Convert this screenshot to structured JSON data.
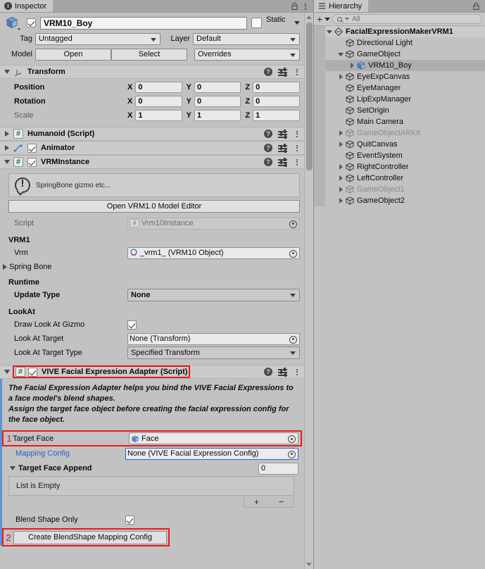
{
  "inspector": {
    "tab_label": "Inspector",
    "tab_icon": "info-icon",
    "object": {
      "name_value": "VRM10_Boy",
      "enabled": true,
      "static_label": "Static",
      "tag_label": "Tag",
      "tag_value": "Untagged",
      "layer_label": "Layer",
      "layer_value": "Default",
      "model_label": "Model",
      "open_label": "Open",
      "select_label": "Select",
      "overrides_label": "Overrides"
    },
    "transform": {
      "title": "Transform",
      "rows": [
        {
          "label": "Position",
          "x": "0",
          "y": "0",
          "z": "0"
        },
        {
          "label": "Rotation",
          "x": "0",
          "y": "0",
          "z": "0"
        },
        {
          "label": "Scale",
          "x": "1",
          "y": "1",
          "z": "1"
        }
      ],
      "axis": {
        "x": "X",
        "y": "Y",
        "z": "Z"
      }
    },
    "components": [
      {
        "title": "Humanoid (Script)",
        "has_checkbox": false
      },
      {
        "title": "Animator",
        "has_checkbox": true
      },
      {
        "title": "VRMInstance",
        "has_checkbox": true
      }
    ],
    "vrminstance": {
      "helpbox_text": "SpringBone gizmo etc...",
      "open_editor_button": "Open VRM1.0 Model Editor",
      "script_label": "Script",
      "script_value": "Vrm10Instance",
      "section_vrm1": "VRM1",
      "vrm_label": "Vrm",
      "vrm_value": "_vrm1_ (VRM10 Object)",
      "spring_bone_label": "Spring Bone",
      "section_runtime": "Runtime",
      "update_type_label": "Update Type",
      "update_type_value": "None",
      "section_lookat": "LookAt",
      "draw_gizmo_label": "Draw Look At Gizmo",
      "draw_gizmo_checked": true,
      "look_at_target_label": "Look At Target",
      "look_at_target_value": "None (Transform)",
      "look_at_type_label": "Look At Target Type",
      "look_at_type_value": "Specified Transform"
    },
    "vive_adapter": {
      "title": "VIVE Facial Expression Adapter (Script)",
      "enabled": true,
      "description": "The Facial Expression Adapter helps you bind the VIVE Facial Expressions to a face model's blend shapes.\nAssign the target face object before creating the facial expression config for the face object.",
      "marker_1": "1",
      "target_face_label": "Target Face",
      "target_face_value": "Face",
      "mapping_config_label": "Mapping Config",
      "mapping_config_value": "None (VIVE Facial Expression Config)",
      "target_face_append_label": "Target Face Append",
      "target_face_append_count": "0",
      "list_empty_label": "List is Empty",
      "list_add": "+",
      "list_remove": "−",
      "blend_shape_only_label": "Blend Shape Only",
      "blend_shape_only_checked": true,
      "marker_2": "2",
      "create_button_label": "Create BlendShape Mapping Config"
    }
  },
  "hierarchy": {
    "tab_label": "Hierarchy",
    "tab_icon": "hierarchy-icon",
    "add_button": "+",
    "search_placeholder": "All",
    "items": [
      {
        "label": "FacialExpressionMakerVRM1",
        "depth": 0,
        "icon": "scene-icon",
        "twisty": "down",
        "scene": true,
        "dimmed": false,
        "selected": false
      },
      {
        "label": "Directional Light",
        "depth": 1,
        "icon": "gameobject-icon",
        "twisty": "none",
        "scene": false,
        "dimmed": false,
        "selected": false
      },
      {
        "label": "GameObject",
        "depth": 1,
        "icon": "gameobject-icon",
        "twisty": "down",
        "scene": false,
        "dimmed": false,
        "selected": false
      },
      {
        "label": "VRM10_Boy",
        "depth": 2,
        "icon": "prefab-icon",
        "twisty": "right",
        "scene": false,
        "dimmed": false,
        "selected": true
      },
      {
        "label": "EyeExpCanvas",
        "depth": 1,
        "icon": "gameobject-icon",
        "twisty": "right",
        "scene": false,
        "dimmed": false,
        "selected": false
      },
      {
        "label": "EyeManager",
        "depth": 1,
        "icon": "gameobject-icon",
        "twisty": "none",
        "scene": false,
        "dimmed": false,
        "selected": false
      },
      {
        "label": "LipExpManager",
        "depth": 1,
        "icon": "gameobject-icon",
        "twisty": "none",
        "scene": false,
        "dimmed": false,
        "selected": false
      },
      {
        "label": "SetOrigin",
        "depth": 1,
        "icon": "gameobject-icon",
        "twisty": "none",
        "scene": false,
        "dimmed": false,
        "selected": false
      },
      {
        "label": "Main Camera",
        "depth": 1,
        "icon": "gameobject-icon",
        "twisty": "none",
        "scene": false,
        "dimmed": false,
        "selected": false
      },
      {
        "label": "GameObjectARKit",
        "depth": 1,
        "icon": "gameobject-icon",
        "twisty": "right",
        "scene": false,
        "dimmed": true,
        "selected": false
      },
      {
        "label": "QuitCanvas",
        "depth": 1,
        "icon": "gameobject-icon",
        "twisty": "right",
        "scene": false,
        "dimmed": false,
        "selected": false
      },
      {
        "label": "EventSystem",
        "depth": 1,
        "icon": "gameobject-icon",
        "twisty": "none",
        "scene": false,
        "dimmed": false,
        "selected": false
      },
      {
        "label": "RightController",
        "depth": 1,
        "icon": "gameobject-icon",
        "twisty": "right",
        "scene": false,
        "dimmed": false,
        "selected": false
      },
      {
        "label": "LeftController",
        "depth": 1,
        "icon": "gameobject-icon",
        "twisty": "right",
        "scene": false,
        "dimmed": false,
        "selected": false
      },
      {
        "label": "GameObject1",
        "depth": 1,
        "icon": "gameobject-icon",
        "twisty": "right",
        "scene": false,
        "dimmed": true,
        "selected": false
      },
      {
        "label": "GameObject2",
        "depth": 1,
        "icon": "gameobject-icon",
        "twisty": "right",
        "scene": false,
        "dimmed": false,
        "selected": false
      }
    ]
  },
  "colors": {
    "accent_blue": "#2a62c8",
    "highlight_red": "#e81b1b",
    "panel_bg": "#c2c2c2",
    "header_bg": "#cbcbcb"
  }
}
